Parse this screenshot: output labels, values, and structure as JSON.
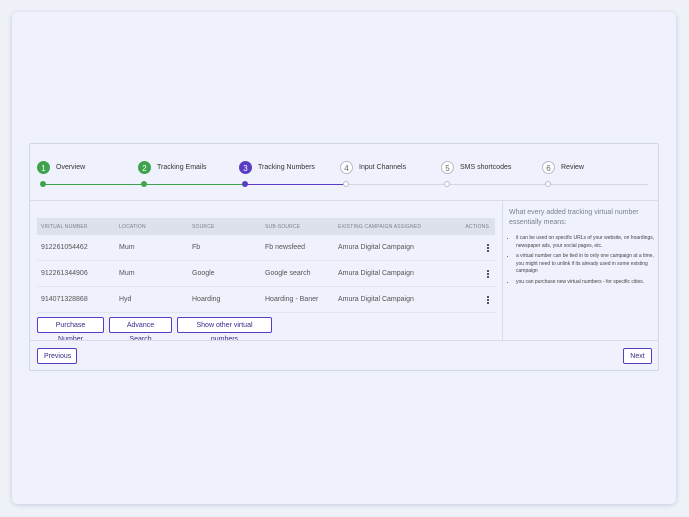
{
  "steps": [
    {
      "num": "1",
      "label": "Overview",
      "state": "done"
    },
    {
      "num": "2",
      "label": "Tracking Emails",
      "state": "done"
    },
    {
      "num": "3",
      "label": "Tracking Numbers",
      "state": "active"
    },
    {
      "num": "4",
      "label": "Input Channels",
      "state": "pending"
    },
    {
      "num": "5",
      "label": "SMS shortcodes",
      "state": "pending"
    },
    {
      "num": "6",
      "label": "Review",
      "state": "pending"
    }
  ],
  "table": {
    "headers": [
      "VIRTUAL NUMBER",
      "LOCATION",
      "SOURCE",
      "SUB-SOURCE",
      "EXISTING CAMPAIGN ASSIGNED",
      "ACTIONS"
    ],
    "rows": [
      [
        "912261054462",
        "Mum",
        "Fb",
        "Fb newsfeed",
        "Amura Digital Campaign"
      ],
      [
        "912261344906",
        "Mum",
        "Google",
        "Google search",
        "Amura Digital Campaign"
      ],
      [
        "914071328868",
        "Hyd",
        "Hoarding",
        "Hoarding - Baner",
        "Amura Digital Campaign"
      ]
    ]
  },
  "buttons": {
    "purchase": "Purchase Number",
    "advance_search": "Advance Search",
    "show_other": "Show other virtual numbers",
    "previous": "Previous",
    "next": "Next"
  },
  "info": {
    "title": "What every added tracking virtual number essentially means:",
    "bullets": [
      "it can be used on specific URLs of your website, on hoardings, newspaper ads, your social pages, etc.",
      "a virtual number can be tied in to only one campaign at a time, you might need to unlink if its already used in some existing campaign",
      "you can purchase new virtual numbers - for specific cities."
    ]
  },
  "colors": {
    "done": "#3fa34d",
    "active": "#5b3cc4",
    "pending": "#b8bcc8"
  }
}
